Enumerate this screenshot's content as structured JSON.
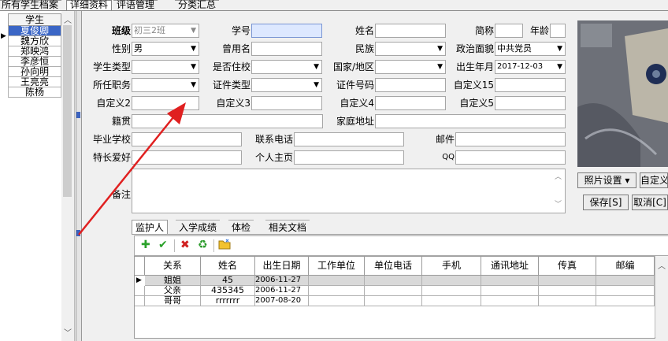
{
  "top_tabs": [
    "所有学生档案",
    "详细资料",
    "评语管理",
    "分类汇总"
  ],
  "student_list": {
    "header": "学生",
    "students": [
      "夏俊卿",
      "魏方欣",
      "郑映鸿",
      "李彦恒",
      "孙向明",
      "王亮亮",
      "陈杨"
    ],
    "selected_index": 0
  },
  "form": {
    "class_label": "班级",
    "class_value": "初三2班",
    "student_no_label": "学号",
    "student_no_value": "",
    "name_label": "姓名",
    "name_value": "",
    "short_label": "简称",
    "short_value": "",
    "age_label": "年龄",
    "age_value": "",
    "gender_label": "性别",
    "gender_value": "男",
    "alias_label": "曾用名",
    "alias_value": "",
    "ethnic_label": "民族",
    "ethnic_value": "",
    "political_label": "政治面貌",
    "political_value": "中共党员",
    "type_label": "学生类型",
    "type_value": "",
    "boarding_label": "是否住校",
    "boarding_value": "",
    "country_label": "国家/地区",
    "country_value": "",
    "birth_label": "出生年月",
    "birth_value": "2017-12-03",
    "position_label": "所任职务",
    "position_value": "",
    "idtype_label": "证件类型",
    "idtype_value": "",
    "idno_label": "证件号码",
    "idno_value": "",
    "custom15_label": "自定义15",
    "custom15_value": "",
    "custom2_label": "自定义2",
    "custom2_value": "",
    "custom3_label": "自定义3",
    "custom3_value": "",
    "custom4_label": "自定义4",
    "custom4_value": "",
    "custom5_label": "自定义5",
    "custom5_value": "",
    "native_label": "籍贯",
    "native_value": "",
    "home_label": "家庭地址",
    "home_value": "",
    "school_label": "毕业学校",
    "school_value": "",
    "phone_label": "联系电话",
    "phone_value": "",
    "email_label": "邮件",
    "email_value": "",
    "hobby_label": "特长爱好",
    "hobby_value": "",
    "homepage_label": "个人主页",
    "homepage_value": "",
    "qq_label": "QQ",
    "qq_value": "",
    "remark_label": "备注",
    "remark_value": ""
  },
  "photo": {
    "settings_button": "照片设置 ▾",
    "custom_button": "自定义",
    "save_button": "保存[S]",
    "cancel_button": "取消[C]"
  },
  "sub_tabs": [
    "监护人",
    "入学成绩",
    "体检",
    "相关文档"
  ],
  "guardian_grid": {
    "columns": [
      "关系",
      "姓名",
      "出生日期",
      "工作单位",
      "单位电话",
      "手机",
      "通讯地址",
      "传真",
      "邮编"
    ],
    "rows": [
      [
        "姐姐",
        "45",
        "2006-11-27",
        "",
        "",
        "",
        "",
        "",
        ""
      ],
      [
        "父亲",
        "435345",
        "2006-11-27",
        "",
        "",
        "",
        "",
        "",
        ""
      ],
      [
        "哥哥",
        "rrrrrrr",
        "2007-08-20",
        "",
        "",
        "",
        "",
        "",
        ""
      ]
    ]
  },
  "colors": {
    "selection": "#3b66c6",
    "annotation_arrow": "#e02020"
  }
}
